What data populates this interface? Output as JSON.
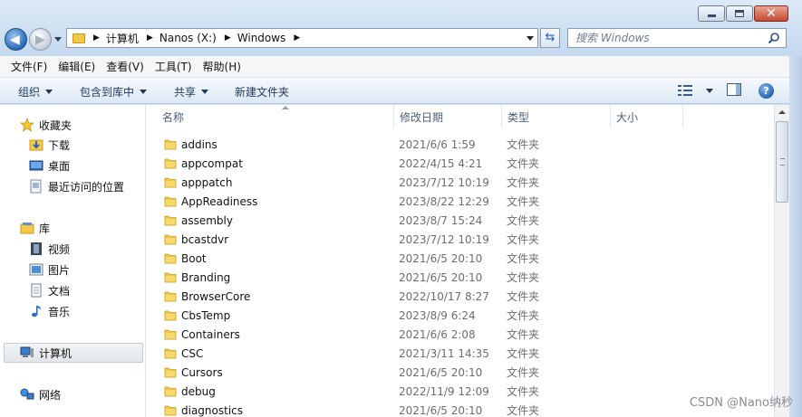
{
  "window": {
    "buttons": {
      "minimize": "",
      "maximize": "",
      "close": "✕"
    }
  },
  "nav": {
    "back_icon": "back-arrow-icon",
    "forward_icon": "forward-arrow-icon",
    "address_crumbs": [
      "计算机",
      "Nanos (X:)",
      "Windows"
    ],
    "search_placeholder": "搜索 Windows"
  },
  "menubar": {
    "items": [
      "文件(F)",
      "编辑(E)",
      "查看(V)",
      "工具(T)",
      "帮助(H)"
    ]
  },
  "toolbar": {
    "organize": "组织",
    "include_library": "包含到库中",
    "share": "共享",
    "new_folder": "新建文件夹",
    "help": "?"
  },
  "sidebar": {
    "favorites": {
      "label": "收藏夹",
      "items": [
        "下载",
        "桌面",
        "最近访问的位置"
      ]
    },
    "libraries": {
      "label": "库",
      "items": [
        "视频",
        "图片",
        "文档",
        "音乐"
      ]
    },
    "computer": "计算机",
    "network": "网络"
  },
  "columns": [
    "名称",
    "修改日期",
    "类型",
    "大小"
  ],
  "files": [
    {
      "name": "addins",
      "date": "2021/6/6 1:59",
      "type": "文件夹"
    },
    {
      "name": "appcompat",
      "date": "2022/4/15 4:21",
      "type": "文件夹"
    },
    {
      "name": "apppatch",
      "date": "2023/7/12 10:19",
      "type": "文件夹"
    },
    {
      "name": "AppReadiness",
      "date": "2023/8/22 12:29",
      "type": "文件夹"
    },
    {
      "name": "assembly",
      "date": "2023/8/7 15:24",
      "type": "文件夹"
    },
    {
      "name": "bcastdvr",
      "date": "2023/7/12 10:19",
      "type": "文件夹"
    },
    {
      "name": "Boot",
      "date": "2021/6/5 20:10",
      "type": "文件夹"
    },
    {
      "name": "Branding",
      "date": "2021/6/5 20:10",
      "type": "文件夹"
    },
    {
      "name": "BrowserCore",
      "date": "2022/10/17 8:27",
      "type": "文件夹"
    },
    {
      "name": "CbsTemp",
      "date": "2023/8/9 6:24",
      "type": "文件夹"
    },
    {
      "name": "Containers",
      "date": "2021/6/6 2:08",
      "type": "文件夹"
    },
    {
      "name": "CSC",
      "date": "2021/3/11 14:35",
      "type": "文件夹"
    },
    {
      "name": "Cursors",
      "date": "2021/6/5 20:10",
      "type": "文件夹"
    },
    {
      "name": "debug",
      "date": "2022/11/9 12:09",
      "type": "文件夹"
    },
    {
      "name": "diagnostics",
      "date": "2021/6/5 20:10",
      "type": "文件夹"
    }
  ],
  "watermark": "CSDN @Nano纳秒"
}
